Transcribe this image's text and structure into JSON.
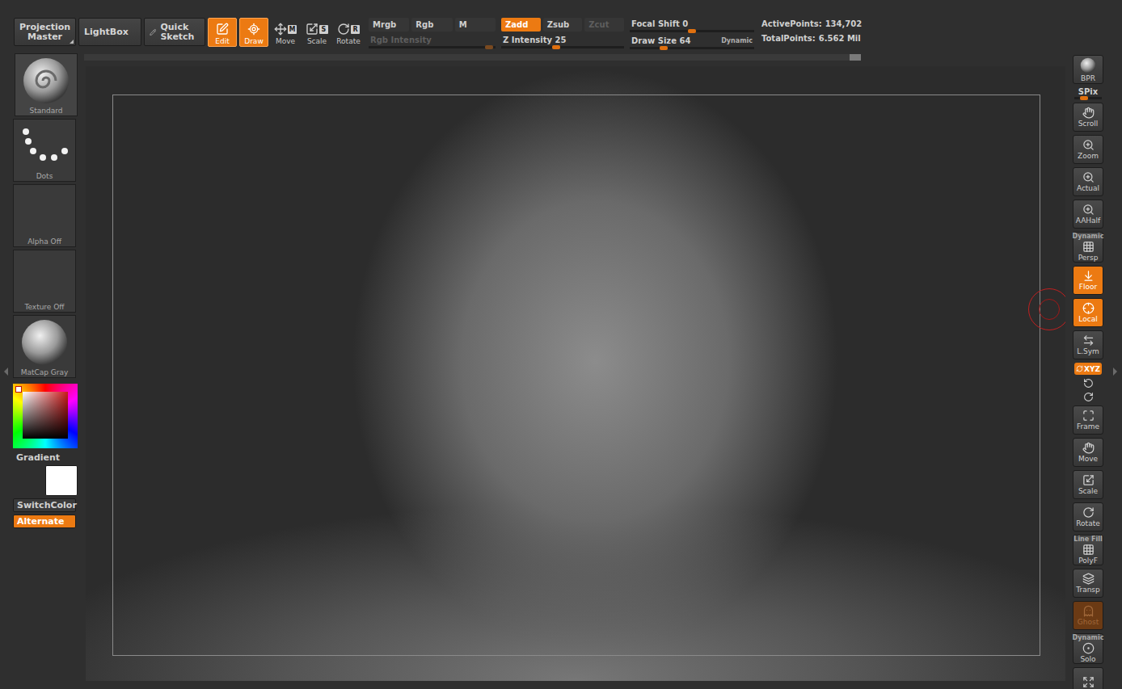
{
  "toolbar": {
    "projection_master": {
      "label": "Projection Master"
    },
    "lightbox": {
      "label": "LightBox"
    },
    "quick_sketch": {
      "label": "Quick Sketch"
    },
    "modes": [
      {
        "label": "Edit",
        "key": "",
        "selected": true
      },
      {
        "label": "Draw",
        "key": "",
        "selected": true
      },
      {
        "label": "Move",
        "key": "M",
        "selected": false
      },
      {
        "label": "Scale",
        "key": "S",
        "selected": false
      },
      {
        "label": "Rotate",
        "key": "R",
        "selected": false
      }
    ],
    "color_channels": [
      {
        "label": "Mrgb",
        "selected": false,
        "disabled": false
      },
      {
        "label": "Rgb",
        "selected": false,
        "disabled": false
      },
      {
        "label": "M",
        "selected": false,
        "disabled": false
      }
    ],
    "rgb_intensity": {
      "label": "Rgb Intensity",
      "value": "",
      "disabled": true,
      "level": 0.95
    },
    "z_modes": [
      {
        "label": "Zadd",
        "selected": true,
        "disabled": false
      },
      {
        "label": "Zsub",
        "selected": false,
        "disabled": false
      },
      {
        "label": "Zcut",
        "selected": false,
        "disabled": true
      }
    ],
    "z_intensity": {
      "label": "Z Intensity",
      "value": "25",
      "disabled": false,
      "level": 0.45
    },
    "focal_shift": {
      "label": "Focal Shift",
      "value": "0",
      "disabled": false,
      "level": 0.5
    },
    "draw_size": {
      "label": "Draw Size",
      "value": "64",
      "disabled": false,
      "level": 0.27
    },
    "dynamic": {
      "label": "Dynamic",
      "on": false
    },
    "stats": [
      {
        "label": "ActivePoints:",
        "value": "134,702"
      },
      {
        "label": "TotalPoints:",
        "value": "6.562 Mil"
      }
    ]
  },
  "left_panel": {
    "tiles": [
      {
        "label": "Standard",
        "kind": "brush"
      },
      {
        "label": "Dots",
        "kind": "stroke"
      },
      {
        "label": "Alpha Off",
        "kind": "empty"
      },
      {
        "label": "Texture Off",
        "kind": "empty"
      },
      {
        "label": "MatCap Gray",
        "kind": "material"
      }
    ],
    "color_picker": {
      "color": "#cc1a1a"
    },
    "gradient": {
      "label": "Gradient",
      "color": "#ffffff"
    },
    "switch_color": {
      "label": "SwitchColor",
      "on": false
    },
    "alternate": {
      "label": "Alternate",
      "on": true
    }
  },
  "right_shelf": [
    {
      "kind": "button",
      "label": "BPR",
      "top_label": "",
      "selected": false,
      "disabled": false,
      "level": 0
    },
    {
      "kind": "slider",
      "label": "SPix",
      "top_label": "",
      "selected": false,
      "disabled": false,
      "level": 0.35
    },
    {
      "kind": "button",
      "label": "Scroll",
      "top_label": "",
      "selected": false,
      "disabled": false,
      "level": 0
    },
    {
      "kind": "button",
      "label": "Zoom",
      "top_label": "",
      "selected": false,
      "disabled": false,
      "level": 0
    },
    {
      "kind": "button",
      "label": "Actual",
      "top_label": "",
      "selected": false,
      "disabled": false,
      "level": 0
    },
    {
      "kind": "button",
      "label": "AAHalf",
      "top_label": "",
      "selected": false,
      "disabled": false,
      "level": 0
    },
    {
      "kind": "button",
      "label": "Persp",
      "top_label": "Dynamic",
      "selected": false,
      "disabled": false,
      "level": 0
    },
    {
      "kind": "button",
      "label": "Floor",
      "top_label": "",
      "selected": true,
      "disabled": false,
      "level": 0
    },
    {
      "kind": "button",
      "label": "Local",
      "top_label": "",
      "selected": true,
      "disabled": false,
      "level": 0
    },
    {
      "kind": "button",
      "label": "L.Sym",
      "top_label": "",
      "selected": false,
      "disabled": false,
      "level": 0
    },
    {
      "kind": "toggle",
      "label": "XYZ",
      "top_label": "",
      "selected": true,
      "disabled": false,
      "level": 0
    },
    {
      "kind": "icon-pair",
      "label": "",
      "top_label": "",
      "selected": false,
      "disabled": false,
      "level": 0
    },
    {
      "kind": "button",
      "label": "Frame",
      "top_label": "",
      "selected": false,
      "disabled": false,
      "level": 0
    },
    {
      "kind": "button",
      "label": "Move",
      "top_label": "",
      "selected": false,
      "disabled": false,
      "level": 0
    },
    {
      "kind": "button",
      "label": "Scale",
      "top_label": "",
      "selected": false,
      "disabled": false,
      "level": 0
    },
    {
      "kind": "button",
      "label": "Rotate",
      "top_label": "",
      "selected": false,
      "disabled": false,
      "level": 0
    },
    {
      "kind": "button",
      "label": "PolyF",
      "top_label": "Line Fill",
      "selected": false,
      "disabled": false,
      "level": 0
    },
    {
      "kind": "button",
      "label": "Transp",
      "top_label": "",
      "selected": false,
      "disabled": false,
      "level": 0
    },
    {
      "kind": "button",
      "label": "Ghost",
      "top_label": "",
      "selected": true,
      "disabled": true,
      "level": 0
    },
    {
      "kind": "button",
      "label": "Solo",
      "top_label": "Dynamic",
      "selected": false,
      "disabled": false,
      "level": 0
    },
    {
      "kind": "button",
      "label": "",
      "top_label": "",
      "selected": false,
      "disabled": false,
      "level": 0
    }
  ]
}
